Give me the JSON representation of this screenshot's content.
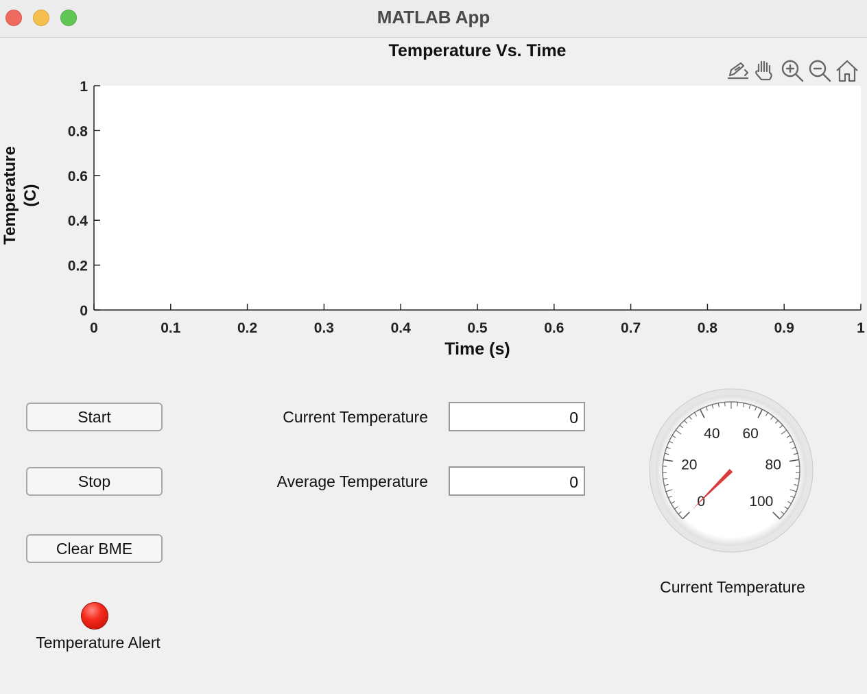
{
  "window": {
    "title": "MATLAB App",
    "controls": [
      "close-button",
      "minimize-button",
      "zoom-button"
    ]
  },
  "axes_toolbar": {
    "icons": [
      "export-icon",
      "pan-hand-icon",
      "zoom-in-icon",
      "zoom-out-icon",
      "restore-view-home-icon"
    ]
  },
  "chart_data": {
    "type": "line",
    "title": "Temperature Vs. Time",
    "xlabel": "Time (s)",
    "ylabel": [
      "Temperature",
      "(C)"
    ],
    "xlim": [
      0,
      1
    ],
    "ylim": [
      0,
      1
    ],
    "xticks": [
      "0",
      "0.1",
      "0.2",
      "0.3",
      "0.4",
      "0.5",
      "0.6",
      "0.7",
      "0.8",
      "0.9",
      "1"
    ],
    "yticks": [
      "0",
      "0.2",
      "0.4",
      "0.6",
      "0.8",
      "1"
    ],
    "series": [],
    "grid": false
  },
  "buttons": {
    "start": "Start",
    "stop": "Stop",
    "clear": "Clear BME"
  },
  "fields": {
    "current_label": "Current Temperature",
    "current_value": "0",
    "average_label": "Average Temperature",
    "average_value": "0"
  },
  "lamp": {
    "label": "Temperature Alert",
    "color": "#e8291c"
  },
  "gauge": {
    "label": "Current Temperature",
    "min": 0,
    "max": 100,
    "major_ticks": [
      "0",
      "20",
      "40",
      "60",
      "80",
      "100"
    ],
    "value": 0,
    "needle_color": "#d93b3b"
  }
}
